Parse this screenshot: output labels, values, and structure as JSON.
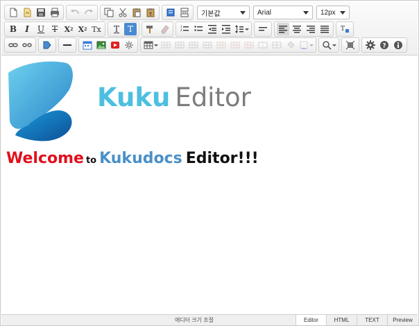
{
  "toolbar": {
    "row1": {
      "format_select": "기본값",
      "font_select": "Arial",
      "size_select": "12px"
    },
    "row2": {
      "bold": "B",
      "italic": "I",
      "underline": "U",
      "strike": "T",
      "superscript": "X",
      "subscript": "X",
      "clear_format": "Tx",
      "text_color": "T",
      "bg_color": "T"
    }
  },
  "content": {
    "brand_primary": "Kuku",
    "brand_secondary": "Editor",
    "welcome_1": "Welcome",
    "welcome_2": "to",
    "welcome_3": "Kukudocs",
    "welcome_4": "Editor!!!"
  },
  "status": {
    "resize_label": "에디터 크기 조절",
    "modes": [
      "Editor",
      "HTML",
      "TEXT",
      "Preview"
    ]
  },
  "colors": {
    "brand_blue": "#4dbfe0",
    "brand_gray": "#7c7c7c",
    "welcome_red": "#e0101c",
    "kukudocs_blue": "#4a90c8"
  }
}
